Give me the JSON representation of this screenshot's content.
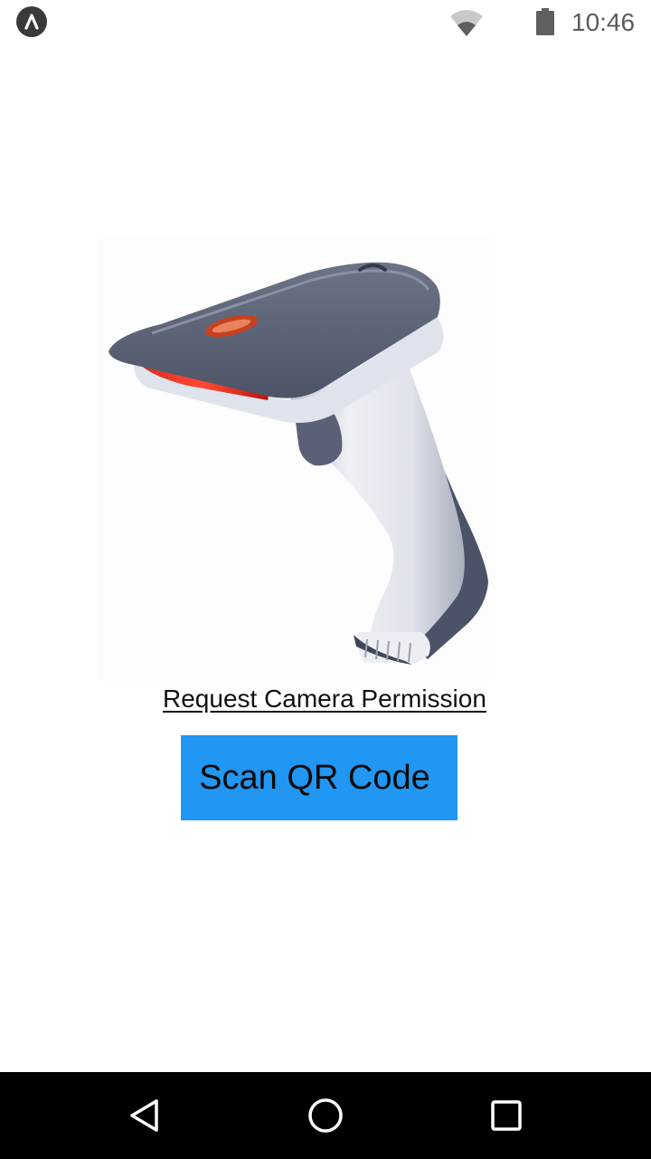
{
  "status_bar": {
    "app_icon": "app-notification-icon",
    "wifi_icon": "wifi-icon",
    "battery_icon": "battery-icon",
    "time": "10:46"
  },
  "main": {
    "image": "barcode-scanner-image",
    "permission_link": "Request Camera Permission",
    "scan_button_label": "Scan QR Code",
    "accent_color": "#2196f3"
  },
  "nav_bar": {
    "back_icon": "back-icon",
    "home_icon": "home-icon",
    "recents_icon": "recents-icon"
  }
}
